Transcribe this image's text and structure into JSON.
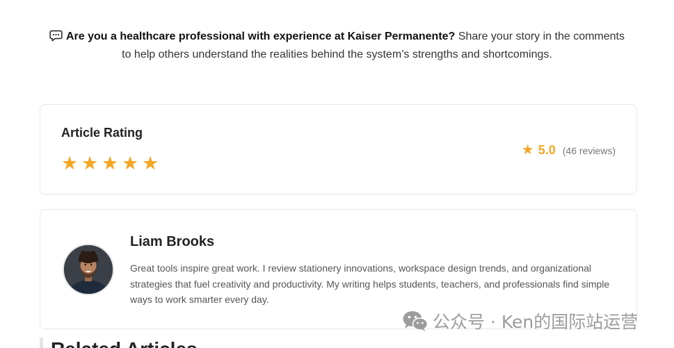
{
  "comment_prompt": {
    "icon": "speech-bubble-icon",
    "bold": "Are you a healthcare professional with experience at Kaiser Permanente?",
    "text_line1": "Share your story in the comments",
    "text_line2": "to help others understand the realities behind the system’s strengths and shortcomings."
  },
  "rating_card": {
    "title": "Article Rating",
    "stars": 5,
    "star_icon": "star-icon",
    "average": "5.0",
    "reviews": "(46 reviews)"
  },
  "author_card": {
    "name": "Liam Brooks",
    "bio": "Great tools inspire great work. I review stationery innovations, workspace design trends, and organizational strategies that fuel creativity and productivity. My writing helps students, teachers, and professionals find simple ways to work smarter every day."
  },
  "related": {
    "heading": "Related Articles"
  },
  "watermark": {
    "icon": "wechat-icon",
    "text": "公众号 · Ken的国际站运营"
  },
  "colors": {
    "star": "#f5a623",
    "card_border": "#e8e8e8",
    "bio_text": "#555555"
  }
}
